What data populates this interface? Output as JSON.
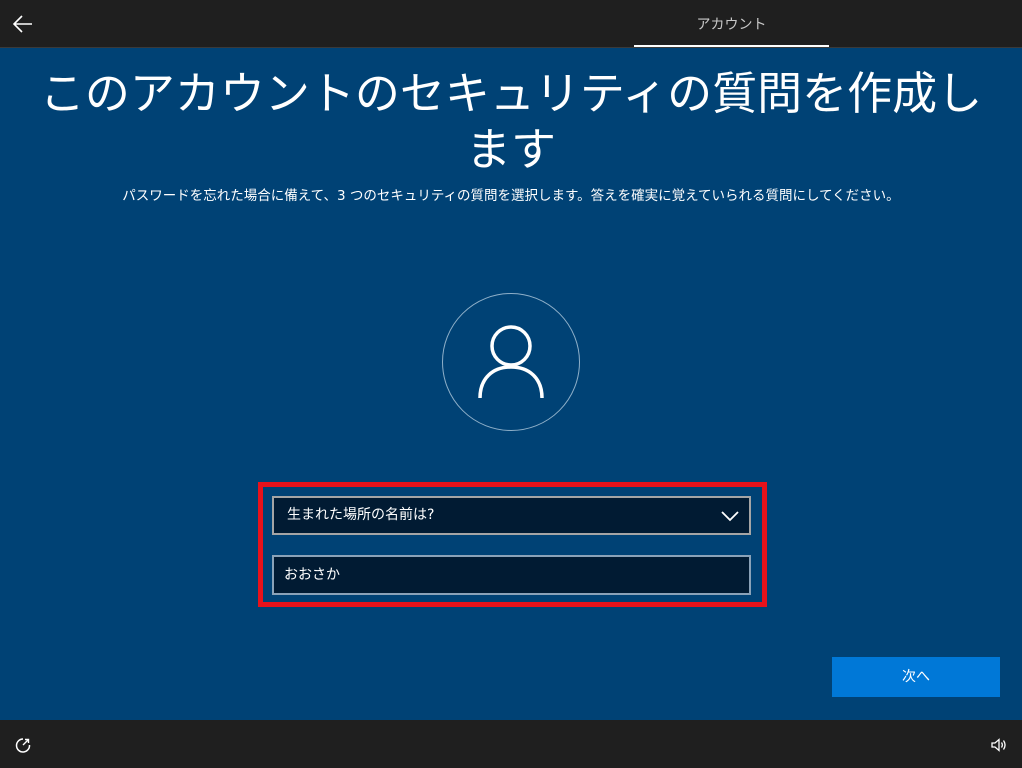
{
  "topbar": {
    "back_icon": "back-arrow-icon",
    "tab_label": "アカウント"
  },
  "main": {
    "title_line1": "このアカウントのセキュリティの質問を作成し",
    "title_line2": "ます",
    "subtitle": "パスワードを忘れた場合に備えて、3 つのセキュリティの質問を選択します。答えを確実に覚えていられる質問にしてください。",
    "avatar_icon": "user-icon"
  },
  "form": {
    "question_selected": "生まれた場所の名前は?",
    "answer_value": "おおさか",
    "highlight_color": "#e8121b"
  },
  "buttons": {
    "next_label": "次へ"
  },
  "taskbar": {
    "accessibility_icon": "ease-of-access-icon",
    "volume_icon": "volume-icon"
  },
  "colors": {
    "background": "#004275",
    "bar": "#1f1f1f",
    "accent": "#0078d7",
    "field": "#011b33"
  }
}
